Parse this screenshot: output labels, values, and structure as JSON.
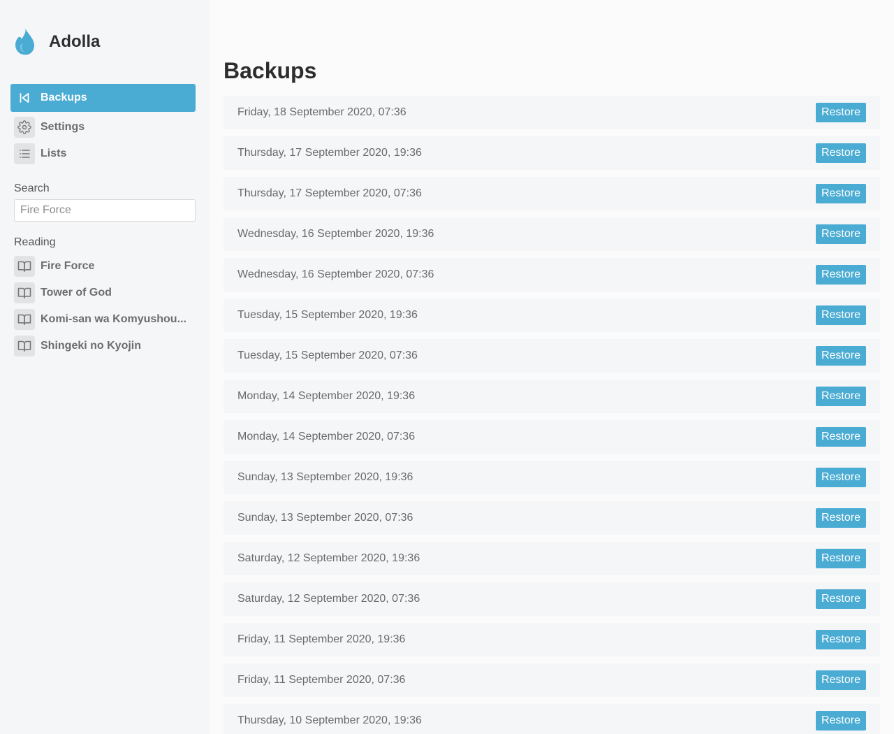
{
  "brand": {
    "name": "Adolla",
    "accent_color": "#4aabd3"
  },
  "nav": {
    "items": [
      {
        "label": "Backups",
        "icon": "skip-back-icon",
        "active": true
      },
      {
        "label": "Settings",
        "icon": "gear-icon",
        "active": false
      },
      {
        "label": "Lists",
        "icon": "list-icon",
        "active": false
      }
    ]
  },
  "search": {
    "label": "Search",
    "placeholder": "Fire Force",
    "value": ""
  },
  "reading": {
    "label": "Reading",
    "items": [
      {
        "title": "Fire Force",
        "icon": "book-open-icon"
      },
      {
        "title": "Tower of God",
        "icon": "book-open-icon"
      },
      {
        "title": "Komi-san wa Komyushou...",
        "icon": "book-open-icon"
      },
      {
        "title": "Shingeki no Kyojin",
        "icon": "book-open-icon"
      }
    ]
  },
  "main": {
    "title": "Backups",
    "restore_label": "Restore",
    "backups": [
      {
        "date": "Friday, 18 September 2020, 07:36"
      },
      {
        "date": "Thursday, 17 September 2020, 19:36"
      },
      {
        "date": "Thursday, 17 September 2020, 07:36"
      },
      {
        "date": "Wednesday, 16 September 2020, 19:36"
      },
      {
        "date": "Wednesday, 16 September 2020, 07:36"
      },
      {
        "date": "Tuesday, 15 September 2020, 19:36"
      },
      {
        "date": "Tuesday, 15 September 2020, 07:36"
      },
      {
        "date": "Monday, 14 September 2020, 19:36"
      },
      {
        "date": "Monday, 14 September 2020, 07:36"
      },
      {
        "date": "Sunday, 13 September 2020, 19:36"
      },
      {
        "date": "Sunday, 13 September 2020, 07:36"
      },
      {
        "date": "Saturday, 12 September 2020, 19:36"
      },
      {
        "date": "Saturday, 12 September 2020, 07:36"
      },
      {
        "date": "Friday, 11 September 2020, 19:36"
      },
      {
        "date": "Friday, 11 September 2020, 07:36"
      },
      {
        "date": "Thursday, 10 September 2020, 19:36"
      }
    ]
  }
}
